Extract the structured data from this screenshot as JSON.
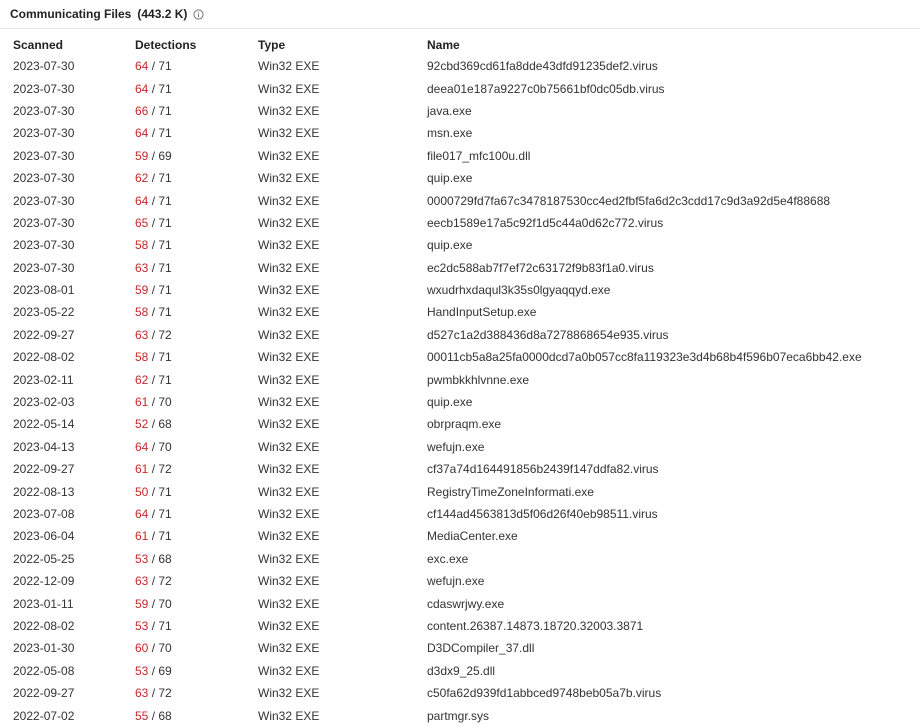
{
  "header": {
    "title": "Communicating Files",
    "count": "(443.2 K)",
    "info_icon": "info-circle-icon"
  },
  "colors": {
    "detection_positive": "#c62828",
    "text": "#333333"
  },
  "table": {
    "columns": [
      "Scanned",
      "Detections",
      "Type",
      "Name"
    ],
    "rows": [
      {
        "scanned": "2023-07-30",
        "pos": "64",
        "total": "71",
        "type": "Win32 EXE",
        "name": "92cbd369cd61fa8dde43dfd91235def2.virus"
      },
      {
        "scanned": "2023-07-30",
        "pos": "64",
        "total": "71",
        "type": "Win32 EXE",
        "name": "deea01e187a9227c0b75661bf0dc05db.virus"
      },
      {
        "scanned": "2023-07-30",
        "pos": "66",
        "total": "71",
        "type": "Win32 EXE",
        "name": "java.exe"
      },
      {
        "scanned": "2023-07-30",
        "pos": "64",
        "total": "71",
        "type": "Win32 EXE",
        "name": "msn.exe"
      },
      {
        "scanned": "2023-07-30",
        "pos": "59",
        "total": "69",
        "type": "Win32 EXE",
        "name": "file017_mfc100u.dll"
      },
      {
        "scanned": "2023-07-30",
        "pos": "62",
        "total": "71",
        "type": "Win32 EXE",
        "name": "quip.exe"
      },
      {
        "scanned": "2023-07-30",
        "pos": "64",
        "total": "71",
        "type": "Win32 EXE",
        "name": "0000729fd7fa67c3478187530cc4ed2fbf5fa6d2c3cdd17c9d3a92d5e4f88688"
      },
      {
        "scanned": "2023-07-30",
        "pos": "65",
        "total": "71",
        "type": "Win32 EXE",
        "name": "eecb1589e17a5c92f1d5c44a0d62c772.virus"
      },
      {
        "scanned": "2023-07-30",
        "pos": "58",
        "total": "71",
        "type": "Win32 EXE",
        "name": "quip.exe"
      },
      {
        "scanned": "2023-07-30",
        "pos": "63",
        "total": "71",
        "type": "Win32 EXE",
        "name": "ec2dc588ab7f7ef72c63172f9b83f1a0.virus"
      },
      {
        "scanned": "2023-08-01",
        "pos": "59",
        "total": "71",
        "type": "Win32 EXE",
        "name": "wxudrhxdaqul3k35s0lgyaqqyd.exe"
      },
      {
        "scanned": "2023-05-22",
        "pos": "58",
        "total": "71",
        "type": "Win32 EXE",
        "name": "HandInputSetup.exe"
      },
      {
        "scanned": "2022-09-27",
        "pos": "63",
        "total": "72",
        "type": "Win32 EXE",
        "name": "d527c1a2d388436d8a7278868654e935.virus"
      },
      {
        "scanned": "2022-08-02",
        "pos": "58",
        "total": "71",
        "type": "Win32 EXE",
        "name": "00011cb5a8a25fa0000dcd7a0b057cc8fa119323e3d4b68b4f596b07eca6bb42.exe"
      },
      {
        "scanned": "2023-02-11",
        "pos": "62",
        "total": "71",
        "type": "Win32 EXE",
        "name": "pwmbkkhlvnne.exe"
      },
      {
        "scanned": "2023-02-03",
        "pos": "61",
        "total": "70",
        "type": "Win32 EXE",
        "name": "quip.exe"
      },
      {
        "scanned": "2022-05-14",
        "pos": "52",
        "total": "68",
        "type": "Win32 EXE",
        "name": "obrpraqm.exe"
      },
      {
        "scanned": "2023-04-13",
        "pos": "64",
        "total": "70",
        "type": "Win32 EXE",
        "name": "wefujn.exe"
      },
      {
        "scanned": "2022-09-27",
        "pos": "61",
        "total": "72",
        "type": "Win32 EXE",
        "name": "cf37a74d164491856b2439f147ddfa82.virus"
      },
      {
        "scanned": "2022-08-13",
        "pos": "50",
        "total": "71",
        "type": "Win32 EXE",
        "name": "RegistryTimeZoneInformati.exe"
      },
      {
        "scanned": "2023-07-08",
        "pos": "64",
        "total": "71",
        "type": "Win32 EXE",
        "name": "cf144ad4563813d5f06d26f40eb98511.virus"
      },
      {
        "scanned": "2023-06-04",
        "pos": "61",
        "total": "71",
        "type": "Win32 EXE",
        "name": "MediaCenter.exe"
      },
      {
        "scanned": "2022-05-25",
        "pos": "53",
        "total": "68",
        "type": "Win32 EXE",
        "name": "exc.exe"
      },
      {
        "scanned": "2022-12-09",
        "pos": "63",
        "total": "72",
        "type": "Win32 EXE",
        "name": "wefujn.exe"
      },
      {
        "scanned": "2023-01-11",
        "pos": "59",
        "total": "70",
        "type": "Win32 EXE",
        "name": "cdaswrjwy.exe"
      },
      {
        "scanned": "2022-08-02",
        "pos": "53",
        "total": "71",
        "type": "Win32 EXE",
        "name": "content.26387.14873.18720.32003.3871"
      },
      {
        "scanned": "2023-01-30",
        "pos": "60",
        "total": "70",
        "type": "Win32 EXE",
        "name": "D3DCompiler_37.dll"
      },
      {
        "scanned": "2022-05-08",
        "pos": "53",
        "total": "69",
        "type": "Win32 EXE",
        "name": "d3dx9_25.dll"
      },
      {
        "scanned": "2022-09-27",
        "pos": "63",
        "total": "72",
        "type": "Win32 EXE",
        "name": "c50fa62d939fd1abbced9748beb05a7b.virus"
      },
      {
        "scanned": "2022-07-02",
        "pos": "55",
        "total": "68",
        "type": "Win32 EXE",
        "name": "partmgr.sys"
      }
    ]
  }
}
